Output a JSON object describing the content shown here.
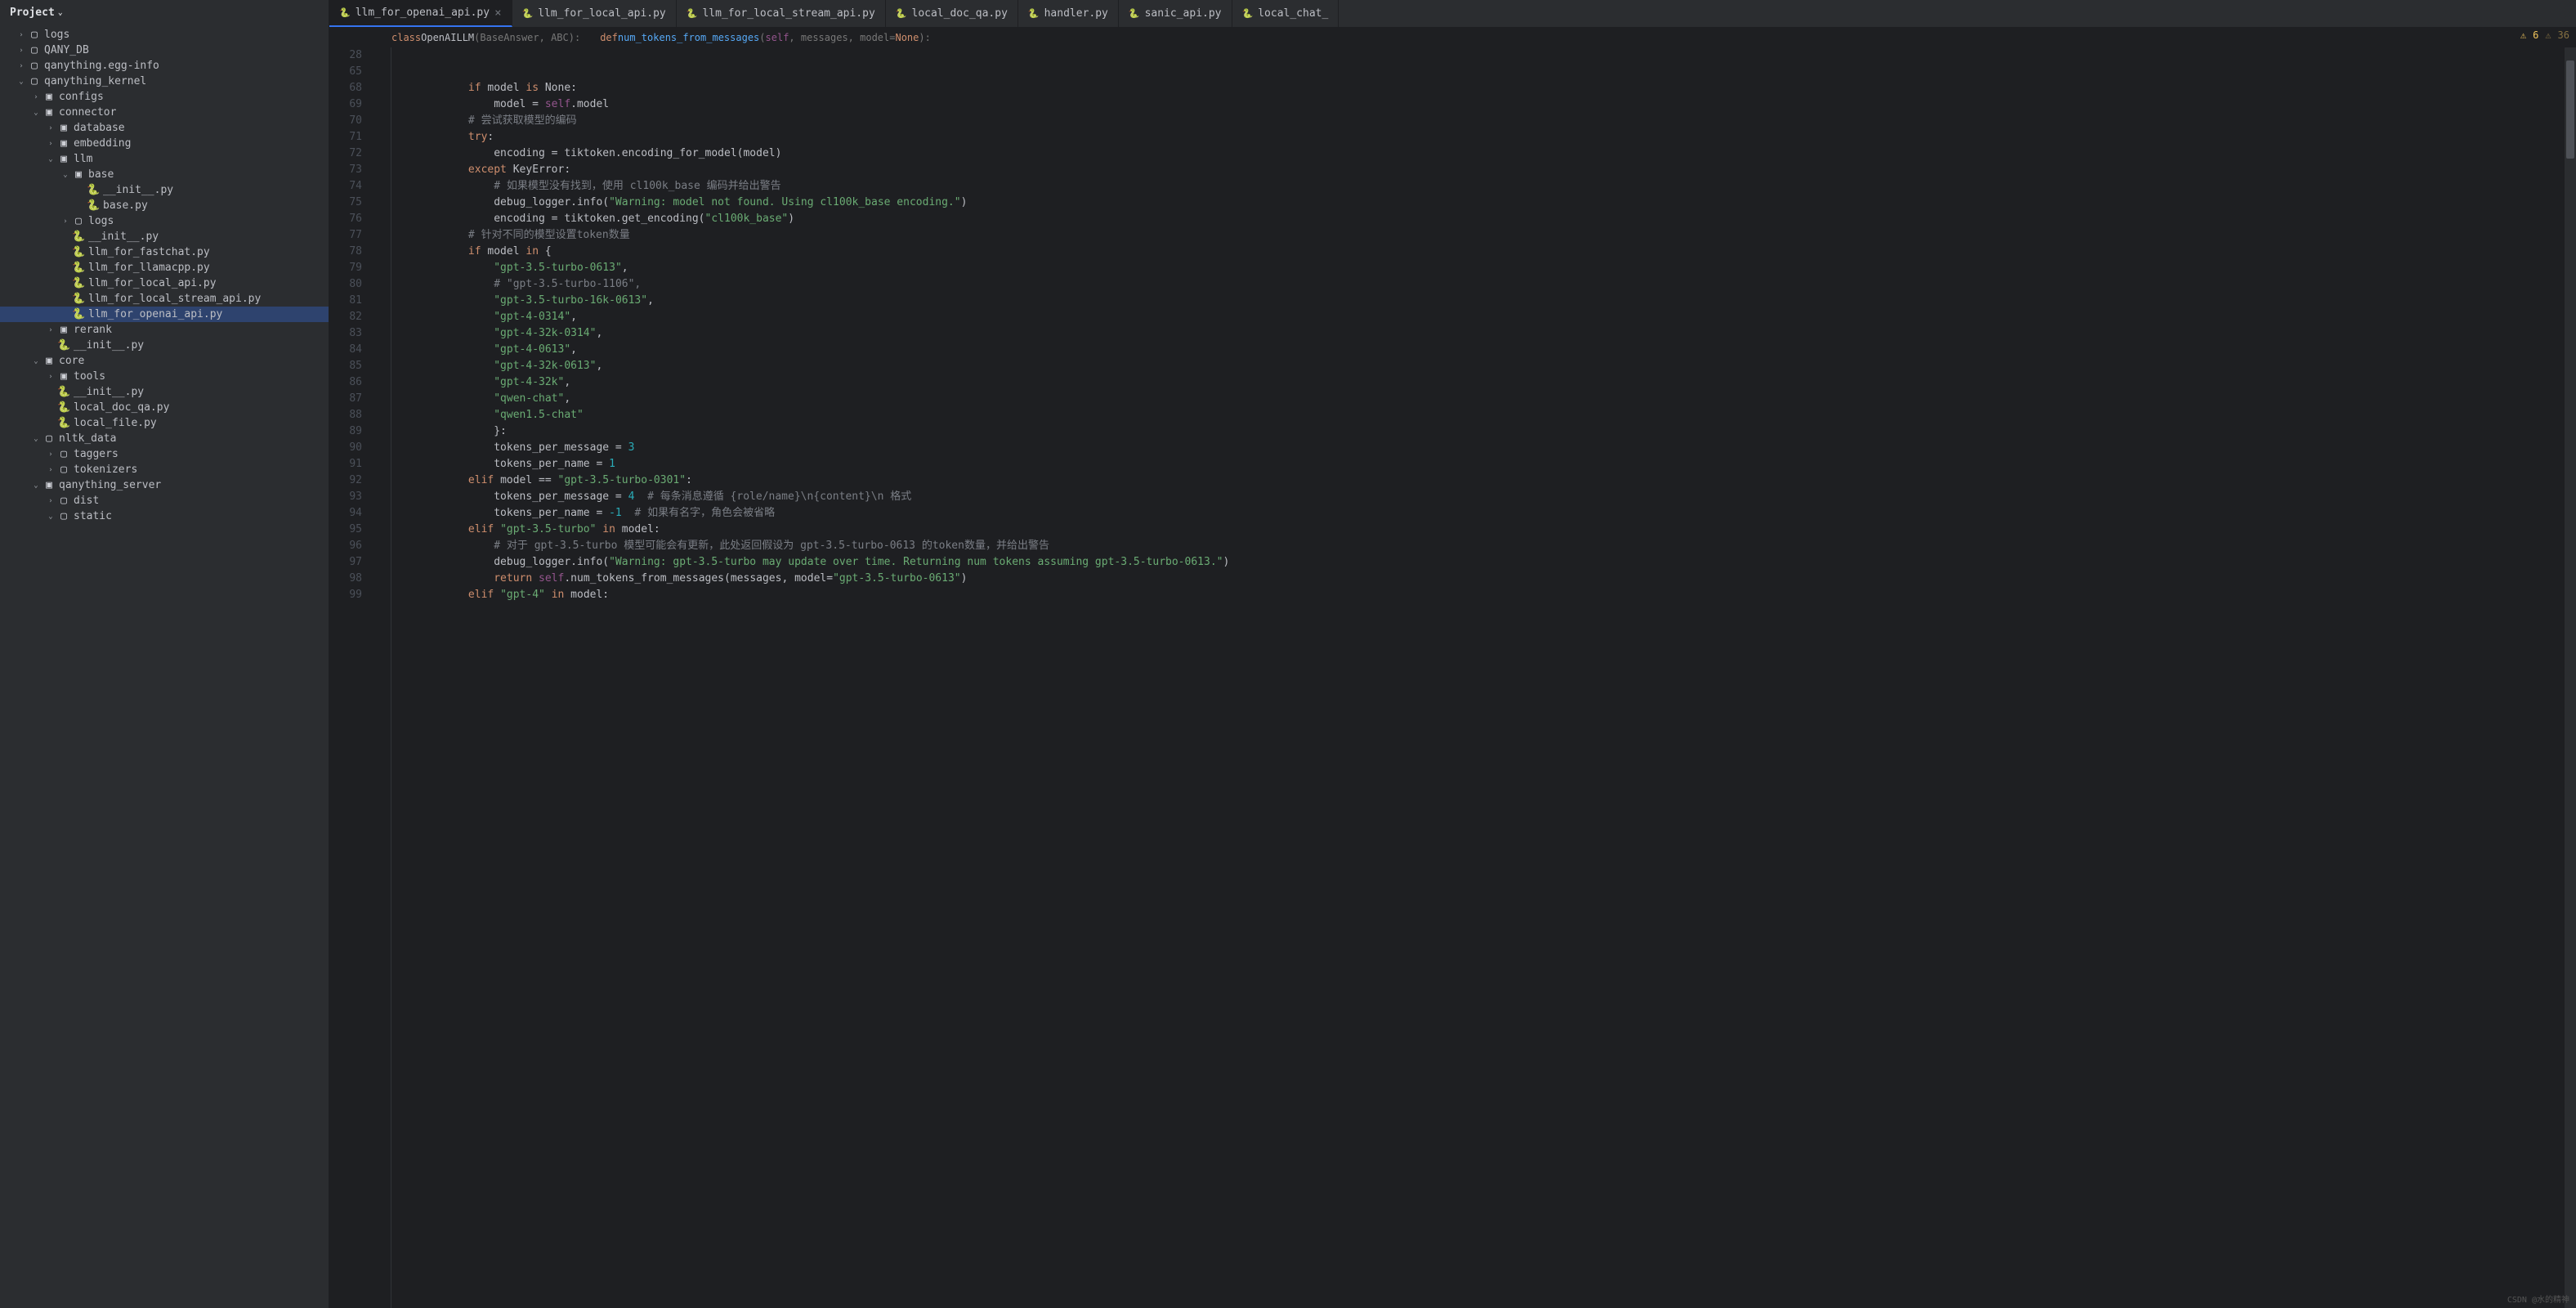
{
  "sidebar": {
    "title": "Project",
    "tree": [
      {
        "depth": 1,
        "arrow": ">",
        "icon": "folder",
        "label": "logs"
      },
      {
        "depth": 1,
        "arrow": ">",
        "icon": "folder",
        "label": "QANY_DB"
      },
      {
        "depth": 1,
        "arrow": ">",
        "icon": "folder",
        "label": "qanything.egg-info"
      },
      {
        "depth": 1,
        "arrow": "v",
        "icon": "folder",
        "label": "qanything_kernel"
      },
      {
        "depth": 2,
        "arrow": ">",
        "icon": "pkg",
        "label": "configs"
      },
      {
        "depth": 2,
        "arrow": "v",
        "icon": "pkg",
        "label": "connector"
      },
      {
        "depth": 3,
        "arrow": ">",
        "icon": "pkg",
        "label": "database"
      },
      {
        "depth": 3,
        "arrow": ">",
        "icon": "pkg",
        "label": "embedding"
      },
      {
        "depth": 3,
        "arrow": "v",
        "icon": "pkg",
        "label": "llm"
      },
      {
        "depth": 4,
        "arrow": "v",
        "icon": "pkg",
        "label": "base"
      },
      {
        "depth": 5,
        "arrow": "",
        "icon": "py",
        "label": "__init__.py"
      },
      {
        "depth": 5,
        "arrow": "",
        "icon": "py",
        "label": "base.py"
      },
      {
        "depth": 4,
        "arrow": ">",
        "icon": "folder",
        "label": "logs"
      },
      {
        "depth": 4,
        "arrow": "",
        "icon": "py",
        "label": "__init__.py"
      },
      {
        "depth": 4,
        "arrow": "",
        "icon": "py",
        "label": "llm_for_fastchat.py"
      },
      {
        "depth": 4,
        "arrow": "",
        "icon": "py",
        "label": "llm_for_llamacpp.py"
      },
      {
        "depth": 4,
        "arrow": "",
        "icon": "py",
        "label": "llm_for_local_api.py"
      },
      {
        "depth": 4,
        "arrow": "",
        "icon": "py",
        "label": "llm_for_local_stream_api.py"
      },
      {
        "depth": 4,
        "arrow": "",
        "icon": "py",
        "label": "llm_for_openai_api.py",
        "selected": true
      },
      {
        "depth": 3,
        "arrow": ">",
        "icon": "pkg",
        "label": "rerank"
      },
      {
        "depth": 3,
        "arrow": "",
        "icon": "py",
        "label": "__init__.py"
      },
      {
        "depth": 2,
        "arrow": "v",
        "icon": "pkg",
        "label": "core"
      },
      {
        "depth": 3,
        "arrow": ">",
        "icon": "pkg",
        "label": "tools"
      },
      {
        "depth": 3,
        "arrow": "",
        "icon": "py",
        "label": "__init__.py"
      },
      {
        "depth": 3,
        "arrow": "",
        "icon": "py",
        "label": "local_doc_qa.py"
      },
      {
        "depth": 3,
        "arrow": "",
        "icon": "py",
        "label": "local_file.py"
      },
      {
        "depth": 2,
        "arrow": "v",
        "icon": "folder",
        "label": "nltk_data"
      },
      {
        "depth": 3,
        "arrow": ">",
        "icon": "folder",
        "label": "taggers"
      },
      {
        "depth": 3,
        "arrow": ">",
        "icon": "folder",
        "label": "tokenizers"
      },
      {
        "depth": 2,
        "arrow": "v",
        "icon": "pkg",
        "label": "qanything_server"
      },
      {
        "depth": 3,
        "arrow": ">",
        "icon": "folder",
        "label": "dist"
      },
      {
        "depth": 3,
        "arrow": "v",
        "icon": "folder",
        "label": "static"
      }
    ]
  },
  "tabs": [
    {
      "label": "llm_for_openai_api.py",
      "active": true,
      "close": true
    },
    {
      "label": "llm_for_local_api.py"
    },
    {
      "label": "llm_for_local_stream_api.py"
    },
    {
      "label": "local_doc_qa.py"
    },
    {
      "label": "handler.py"
    },
    {
      "label": "sanic_api.py"
    },
    {
      "label": "local_chat_"
    }
  ],
  "breadcrumb": {
    "cls_kw": "class ",
    "cls_name": "OpenAILLM",
    "cls_bases": "(BaseAnswer, ABC):",
    "fn_kw": "def ",
    "fn_name": "num_tokens_from_messages",
    "fn_sig_open": "(",
    "fn_self": "self",
    "fn_rest": ", messages, model=",
    "fn_none": "None",
    "fn_close": "):"
  },
  "status": {
    "warn_count": "6",
    "weak_count": "36"
  },
  "line_start": 28,
  "code_lines": [
    {
      "n": 28,
      "html": ""
    },
    {
      "n": 65,
      "html": ""
    },
    {
      "n": 68,
      "segs": [
        [
          "            ",
          ""
        ],
        [
          "if ",
          "kw"
        ],
        [
          "model ",
          ""
        ],
        [
          "is ",
          "kw"
        ],
        [
          "None",
          ""
        ],
        [
          ":",
          ""
        ]
      ]
    },
    {
      "n": 69,
      "segs": [
        [
          "                model = ",
          ""
        ],
        [
          "self",
          "self"
        ],
        [
          ".model",
          ""
        ]
      ]
    },
    {
      "n": 70,
      "segs": [
        [
          "            ",
          ""
        ],
        [
          "# 尝试获取模型的编码",
          "cmt"
        ]
      ]
    },
    {
      "n": 71,
      "segs": [
        [
          "            ",
          ""
        ],
        [
          "try",
          "kw"
        ],
        [
          ":",
          ""
        ]
      ]
    },
    {
      "n": 72,
      "segs": [
        [
          "                encoding = tiktoken.encoding_for_model(model)",
          ""
        ]
      ]
    },
    {
      "n": 73,
      "segs": [
        [
          "            ",
          ""
        ],
        [
          "except ",
          "kw"
        ],
        [
          "KeyError",
          "cls"
        ],
        [
          ":",
          ""
        ]
      ]
    },
    {
      "n": 74,
      "segs": [
        [
          "                ",
          ""
        ],
        [
          "# 如果模型没有找到，使用 cl100k_base 编码并给出警告",
          "cmt"
        ]
      ]
    },
    {
      "n": 75,
      "segs": [
        [
          "                debug_logger.info(",
          ""
        ],
        [
          "\"Warning: model not found. Using cl100k_base encoding.\"",
          "str"
        ],
        [
          ")",
          ""
        ]
      ]
    },
    {
      "n": 76,
      "segs": [
        [
          "                encoding = tiktoken.get_encoding(",
          ""
        ],
        [
          "\"cl100k_base\"",
          "str"
        ],
        [
          ")",
          ""
        ]
      ]
    },
    {
      "n": 77,
      "segs": [
        [
          "            ",
          ""
        ],
        [
          "# 针对不同的模型设置token数量",
          "cmt"
        ]
      ]
    },
    {
      "n": 78,
      "segs": [
        [
          "            ",
          ""
        ],
        [
          "if ",
          "kw"
        ],
        [
          "model ",
          ""
        ],
        [
          "in ",
          "kw"
        ],
        [
          "{",
          ""
        ]
      ]
    },
    {
      "n": 79,
      "segs": [
        [
          "                ",
          ""
        ],
        [
          "\"gpt-3.5-turbo-0613\"",
          "str"
        ],
        [
          ",",
          ""
        ]
      ]
    },
    {
      "n": 80,
      "segs": [
        [
          "                ",
          ""
        ],
        [
          "# \"gpt-3.5-turbo-1106\",",
          "cmt"
        ]
      ]
    },
    {
      "n": 81,
      "segs": [
        [
          "                ",
          ""
        ],
        [
          "\"gpt-3.5-turbo-16k-0613\"",
          "str"
        ],
        [
          ",",
          ""
        ]
      ]
    },
    {
      "n": 82,
      "segs": [
        [
          "                ",
          ""
        ],
        [
          "\"gpt-4-0314\"",
          "str"
        ],
        [
          ",",
          ""
        ]
      ]
    },
    {
      "n": 83,
      "segs": [
        [
          "                ",
          ""
        ],
        [
          "\"gpt-4-32k-0314\"",
          "str"
        ],
        [
          ",",
          ""
        ]
      ]
    },
    {
      "n": 84,
      "segs": [
        [
          "                ",
          ""
        ],
        [
          "\"gpt-4-0613\"",
          "str"
        ],
        [
          ",",
          ""
        ]
      ]
    },
    {
      "n": 85,
      "segs": [
        [
          "                ",
          ""
        ],
        [
          "\"gpt-4-32k-0613\"",
          "str"
        ],
        [
          ",",
          ""
        ]
      ]
    },
    {
      "n": 86,
      "segs": [
        [
          "                ",
          ""
        ],
        [
          "\"gpt-4-32k\"",
          "str"
        ],
        [
          ",",
          ""
        ]
      ]
    },
    {
      "n": 87,
      "segs": [
        [
          "                ",
          ""
        ],
        [
          "\"qwen-chat\"",
          "str"
        ],
        [
          ",",
          ""
        ]
      ]
    },
    {
      "n": 88,
      "segs": [
        [
          "                ",
          ""
        ],
        [
          "\"qwen1.5-chat\"",
          "str"
        ]
      ]
    },
    {
      "n": 89,
      "segs": [
        [
          "                }:",
          ""
        ]
      ]
    },
    {
      "n": 90,
      "segs": [
        [
          "                tokens_per_message = ",
          ""
        ],
        [
          "3",
          "num"
        ]
      ]
    },
    {
      "n": 91,
      "segs": [
        [
          "                tokens_per_name = ",
          ""
        ],
        [
          "1",
          "num"
        ]
      ]
    },
    {
      "n": 92,
      "segs": [
        [
          "            ",
          ""
        ],
        [
          "elif ",
          "kw"
        ],
        [
          "model == ",
          ""
        ],
        [
          "\"gpt-3.5-turbo-0301\"",
          "str"
        ],
        [
          ":",
          ""
        ]
      ]
    },
    {
      "n": 93,
      "segs": [
        [
          "                tokens_per_message = ",
          ""
        ],
        [
          "4",
          "num"
        ],
        [
          "  ",
          ""
        ],
        [
          "# 每条消息遵循 {role/name}\\n{content}\\n 格式",
          "cmt"
        ]
      ]
    },
    {
      "n": 94,
      "segs": [
        [
          "                tokens_per_name = ",
          ""
        ],
        [
          "-1",
          "num"
        ],
        [
          "  ",
          ""
        ],
        [
          "# 如果有名字，角色会被省略",
          "cmt"
        ]
      ]
    },
    {
      "n": 95,
      "segs": [
        [
          "            ",
          ""
        ],
        [
          "elif ",
          "kw"
        ],
        [
          "\"gpt-3.5-turbo\"",
          "str"
        ],
        [
          " ",
          ""
        ],
        [
          "in ",
          "kw"
        ],
        [
          "model:",
          ""
        ]
      ]
    },
    {
      "n": 96,
      "segs": [
        [
          "                ",
          ""
        ],
        [
          "# 对于 gpt-3.5-turbo 模型可能会有更新，此处返回假设为 gpt-3.5-turbo-0613 的token数量，并给出警告",
          "cmt"
        ]
      ]
    },
    {
      "n": 97,
      "segs": [
        [
          "                debug_logger.info(",
          ""
        ],
        [
          "\"Warning: gpt-3.5-turbo may update over time. Returning num tokens assuming gpt-3.5-turbo-0613.\"",
          "str"
        ],
        [
          ")",
          ""
        ]
      ]
    },
    {
      "n": 98,
      "segs": [
        [
          "                ",
          ""
        ],
        [
          "return ",
          "kw"
        ],
        [
          "self",
          "self"
        ],
        [
          ".num_tokens_from_messages(messages, ",
          ""
        ],
        [
          "model",
          "op"
        ],
        [
          "=",
          ""
        ],
        [
          "\"gpt-3.5-turbo-0613\"",
          "str"
        ],
        [
          ")",
          ""
        ]
      ]
    },
    {
      "n": 99,
      "segs": [
        [
          "            ",
          ""
        ],
        [
          "elif ",
          "kw"
        ],
        [
          "\"gpt-4\"",
          "str"
        ],
        [
          " ",
          ""
        ],
        [
          "in ",
          "kw"
        ],
        [
          "model:",
          ""
        ]
      ]
    }
  ],
  "watermark": "CSDN @水的精神"
}
